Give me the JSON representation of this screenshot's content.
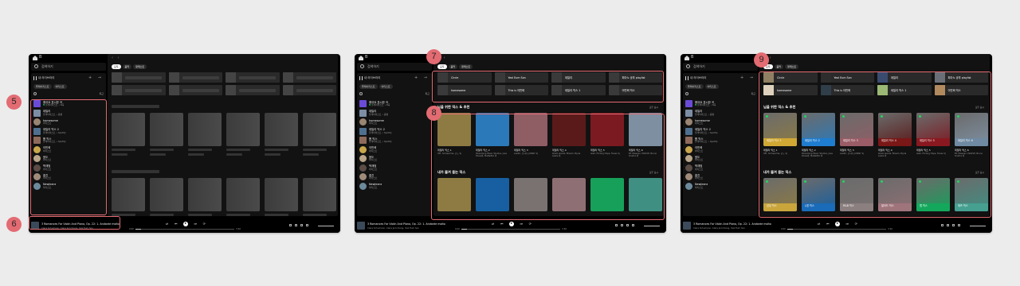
{
  "common": {
    "topbar_glyph": "B",
    "search_placeholder": "검색하기",
    "library_title": "내 라이브러리",
    "library_actions": "+ →",
    "library_chips": [
      "플레이리스트",
      "아티스트"
    ],
    "library_recent": "최근",
    "nav_arrows": "‹ ›",
    "main_chips": [
      "모두",
      "음악",
      "팟캐스트"
    ],
    "library_items": [
      {
        "title": "좋아요 표시한 곡",
        "subtitle": "플레이리스트 • 8곡",
        "pinned": true,
        "color": "#6a4bd8",
        "round": false
      },
      {
        "title": "데일리",
        "subtitle": "플레이리스트 • 음황",
        "color": "#7c8ea4",
        "round": false
      },
      {
        "title": "homesome",
        "subtitle": "아티스트",
        "color": "#9a8572",
        "round": true
      },
      {
        "title": "데일리 믹스 2",
        "subtitle": "플레이리스트 • Spotify",
        "color": "#4f6f8f",
        "round": false
      },
      {
        "title": "톱 믹스",
        "subtitle": "플레이리스트 • Spotify",
        "color": "#8e6a5a",
        "round": false
      },
      {
        "title": "이민혁",
        "subtitle": "아티스트",
        "color": "#c9a64b",
        "round": true
      },
      {
        "title": "윤도",
        "subtitle": "아티스트",
        "color": "#b9a58a",
        "round": true
      },
      {
        "title": "박재범",
        "subtitle": "아티스트",
        "color": "#5b4c46",
        "round": true
      },
      {
        "title": "홍진",
        "subtitle": "아티스트",
        "color": "#a08a7a",
        "round": true
      },
      {
        "title": "NewJeans",
        "subtitle": "아티스트",
        "color": "#6c8a9c",
        "round": true
      }
    ],
    "player": {
      "title": "3 Romances For Violin And Piano, Op. 22: 1. Andante molto",
      "artist": "Clara Schumann, Clara Jumi Kang, Yeol Eum Son",
      "elapsed": "0:00",
      "duration": "3:40",
      "progress": 0.06
    }
  },
  "shortcuts": [
    {
      "label": "Circle",
      "color": "#8f7f63"
    },
    {
      "label": "Yeol Eum Son",
      "color": "#2d2d2d"
    },
    {
      "label": "데일리",
      "color": "#3a4b70"
    },
    {
      "label": "피아노 공부 playlist",
      "color": "#6a6f77"
    },
    {
      "label": "homesome",
      "color": "#ddd0bd"
    },
    {
      "label": "This is 이민혁",
      "color": "#2f3e48"
    },
    {
      "label": "데일리 믹스 1",
      "color": "#9bb874"
    },
    {
      "label": "이민혁 믹스",
      "color": "#b18a5e"
    }
  ],
  "section1": {
    "title": "님을 위한 믹스 & 추천",
    "more": "모두 표시",
    "cards": [
      {
        "title": "데일리 믹스 1",
        "subtitle": "IVE, homesome, 윤도 외",
        "color": "#8d7b43",
        "cover_label": "데일리 믹스 1",
        "band": "#d1a834"
      },
      {
        "title": "데일리 믹스 2",
        "subtitle": "Streaming Music Studios, Jose Rivas외, MaRaiBoi 외",
        "color": "#2b79b8",
        "cover_label": "데일리 믹스 2",
        "band": "#1f7dcf"
      },
      {
        "title": "데일리 믹스 3",
        "subtitle": "LeeSC, 손디아, JUNNY 외",
        "color": "#8f5e65",
        "cover_label": "데일리 믹스 3",
        "band": "#9a5c66"
      },
      {
        "title": "데일리 믹스 4",
        "subtitle": "shark woods, Eilsam, Myria Lewis 외",
        "color": "#5b1a1a",
        "cover_label": "데일리 믹스 4",
        "band": "#7a1717"
      },
      {
        "title": "데일리 믹스 5",
        "subtitle": "isaiii, Finding Hope, Fanes 외",
        "color": "#7c1a22",
        "cover_label": "데일리 믹스 5",
        "band": "#8a1820"
      },
      {
        "title": "데일리 믹스 6",
        "subtitle": "Ed Sheeran, MAXVE, Bruno Scadra 외",
        "color": "#7d8fa1",
        "cover_label": "데일리 믹스 6",
        "band": "#6f8aa2"
      }
    ]
  },
  "section2": {
    "title": "내가 즐겨 듣는 믹스",
    "more": "모두 표시",
    "cards": [
      {
        "title": "감성 믹스",
        "color": "#8d7b43",
        "cover_label": "감성 믹스",
        "band": "#c9a53c"
      },
      {
        "title": "J-팝 믹스",
        "color": "#175fa0",
        "cover_label": "J-팝 믹스",
        "band": "#1a6bb8"
      },
      {
        "title": "R&B 믹스",
        "color": "#7a7171",
        "cover_label": "R&B 믹스",
        "band": "#8b7f7f"
      },
      {
        "title": "발라드 믹스",
        "color": "#8e6f74",
        "cover_label": "발라드 믹스",
        "band": "#a0747b"
      },
      {
        "title": "랩 믹스",
        "color": "#16a05a",
        "cover_label": "랩 믹스",
        "band": "#14a85c"
      },
      {
        "title": "재즈 믹스",
        "color": "#3f8f82",
        "cover_label": "재즈 믹스",
        "band": "#45a090"
      }
    ]
  },
  "badges": [
    "5",
    "6",
    "7",
    "8",
    "9"
  ],
  "colors": {
    "accent": "#e36b72",
    "spotify_green": "#1ed760",
    "background": "#ececec"
  }
}
